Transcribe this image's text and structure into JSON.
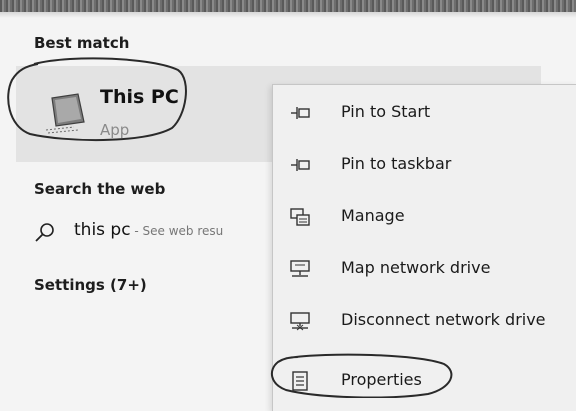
{
  "search_results": {
    "best_match_heading": "Best match",
    "best_match": {
      "title": "This PC",
      "subtitle": "App",
      "icon": "computer-icon"
    },
    "search_web_heading": "Search the web",
    "web_result": {
      "query": "this pc",
      "suffix": " - See web resu",
      "icon": "search-icon"
    },
    "settings_heading": "Settings (7+)"
  },
  "context_menu": {
    "items": [
      {
        "label": "Pin to Start",
        "icon": "pin-icon"
      },
      {
        "label": "Pin to taskbar",
        "icon": "pin-icon"
      },
      {
        "label": "Manage",
        "icon": "manage-icon"
      },
      {
        "label": "Map network drive",
        "icon": "map-network-drive-icon"
      },
      {
        "label": "Disconnect network drive",
        "icon": "disconnect-network-drive-icon"
      },
      {
        "label": "Properties",
        "icon": "properties-icon"
      }
    ]
  }
}
